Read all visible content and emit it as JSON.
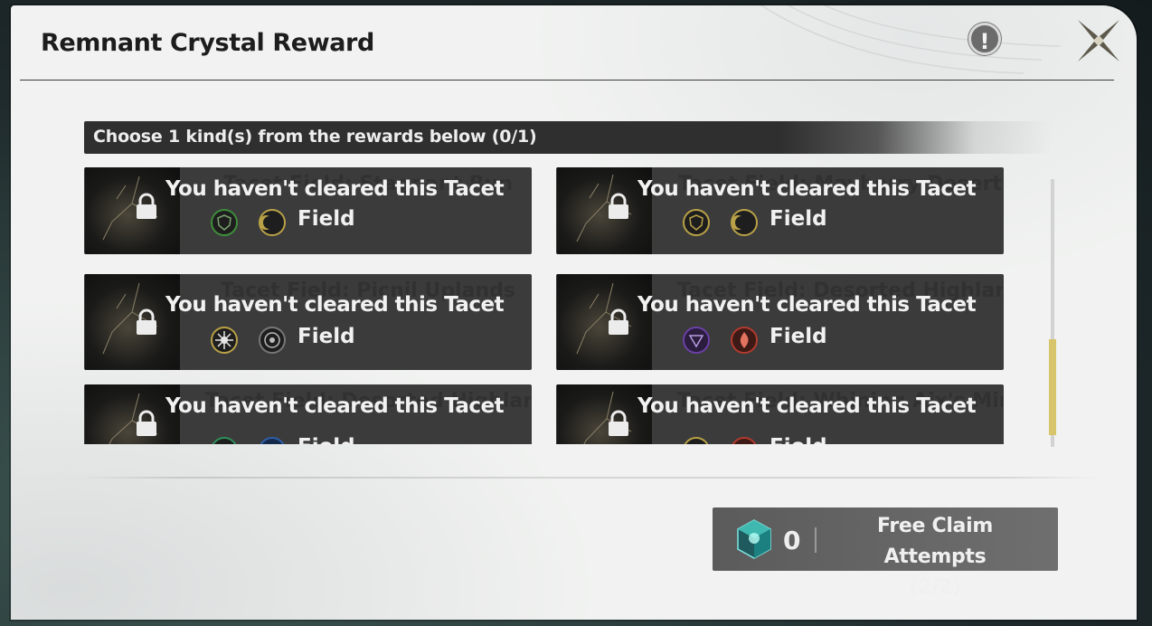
{
  "dialog": {
    "title": "Remnant Crystal Reward",
    "info_symbol": "!"
  },
  "rewards": {
    "instruction": "Choose 1 kind(s) from the rewards below (0/1)",
    "locked_message": "You haven't cleared this Tacet",
    "field_label": "Field",
    "cards": [
      {
        "ghost_title": "Tacet Field: Stagnant Run",
        "icons": [
          "shield-icon",
          "crescent-icon"
        ],
        "colors": [
          "#3e8e3a",
          "#b8a146"
        ]
      },
      {
        "ghost_title": "Tacet Field: Mayberry Desert",
        "icons": [
          "shield-icon",
          "crescent-icon"
        ],
        "colors": [
          "#b8a146",
          "#b8a146"
        ]
      },
      {
        "ghost_title": "Tacet Field: Picnil Uplands",
        "icons": [
          "star-icon",
          "target-icon"
        ],
        "colors": [
          "#b8a146",
          "#777777"
        ]
      },
      {
        "ghost_title": "Tacet Field: Desorted Highland II",
        "icons": [
          "wind-icon",
          "flame-icon"
        ],
        "colors": [
          "#6b3fa8",
          "#b33a2e"
        ]
      },
      {
        "ghost_title": "Tacet Field: Desorted Highland I",
        "icons": [
          "wave-icon",
          "snowflake-icon"
        ],
        "colors": [
          "#2f8f5a",
          "#2e5ea8"
        ]
      },
      {
        "ghost_title": "Tacet Field: Whining Aix's Mire",
        "icons": [
          "star-icon",
          "flame-icon"
        ],
        "colors": [
          "#b8a146",
          "#b33a2e"
        ]
      }
    ]
  },
  "claim": {
    "count": "0",
    "label_line1": "Free Claim Attempts",
    "label_line2": "(2/2)"
  },
  "colors": {
    "panel": "#f1f2f1",
    "card": "#3b3b3b",
    "scroll_thumb": "#d8c46a"
  }
}
